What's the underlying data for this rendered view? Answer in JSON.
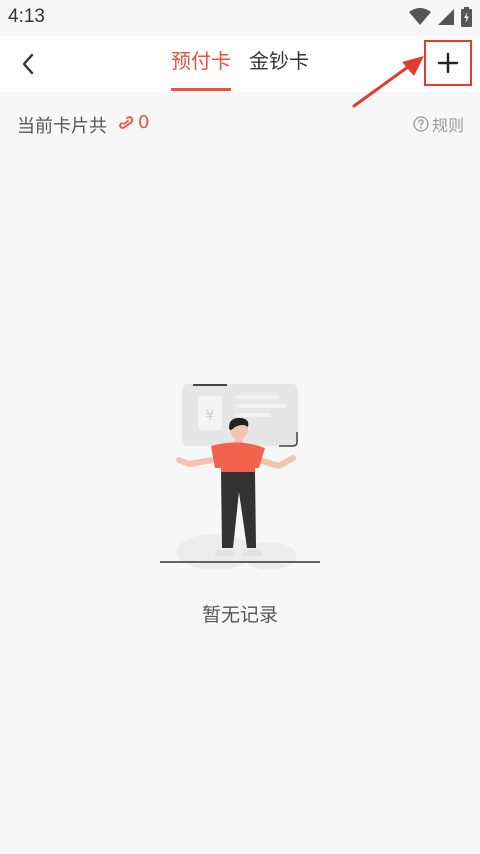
{
  "status_bar": {
    "time": "4:13"
  },
  "nav": {
    "back_icon": "chevron-left-icon",
    "tabs": [
      {
        "label": "预付卡",
        "active": true
      },
      {
        "label": "金钞卡",
        "active": false
      }
    ],
    "add_icon": "plus-icon"
  },
  "summary": {
    "label": "当前卡片共",
    "count": "0",
    "rules_label": "规则"
  },
  "empty_state": {
    "message": "暂无记录"
  },
  "colors": {
    "accent": "#e8503f",
    "highlight_box": "#e23b2f",
    "background": "#f7f7f7"
  }
}
